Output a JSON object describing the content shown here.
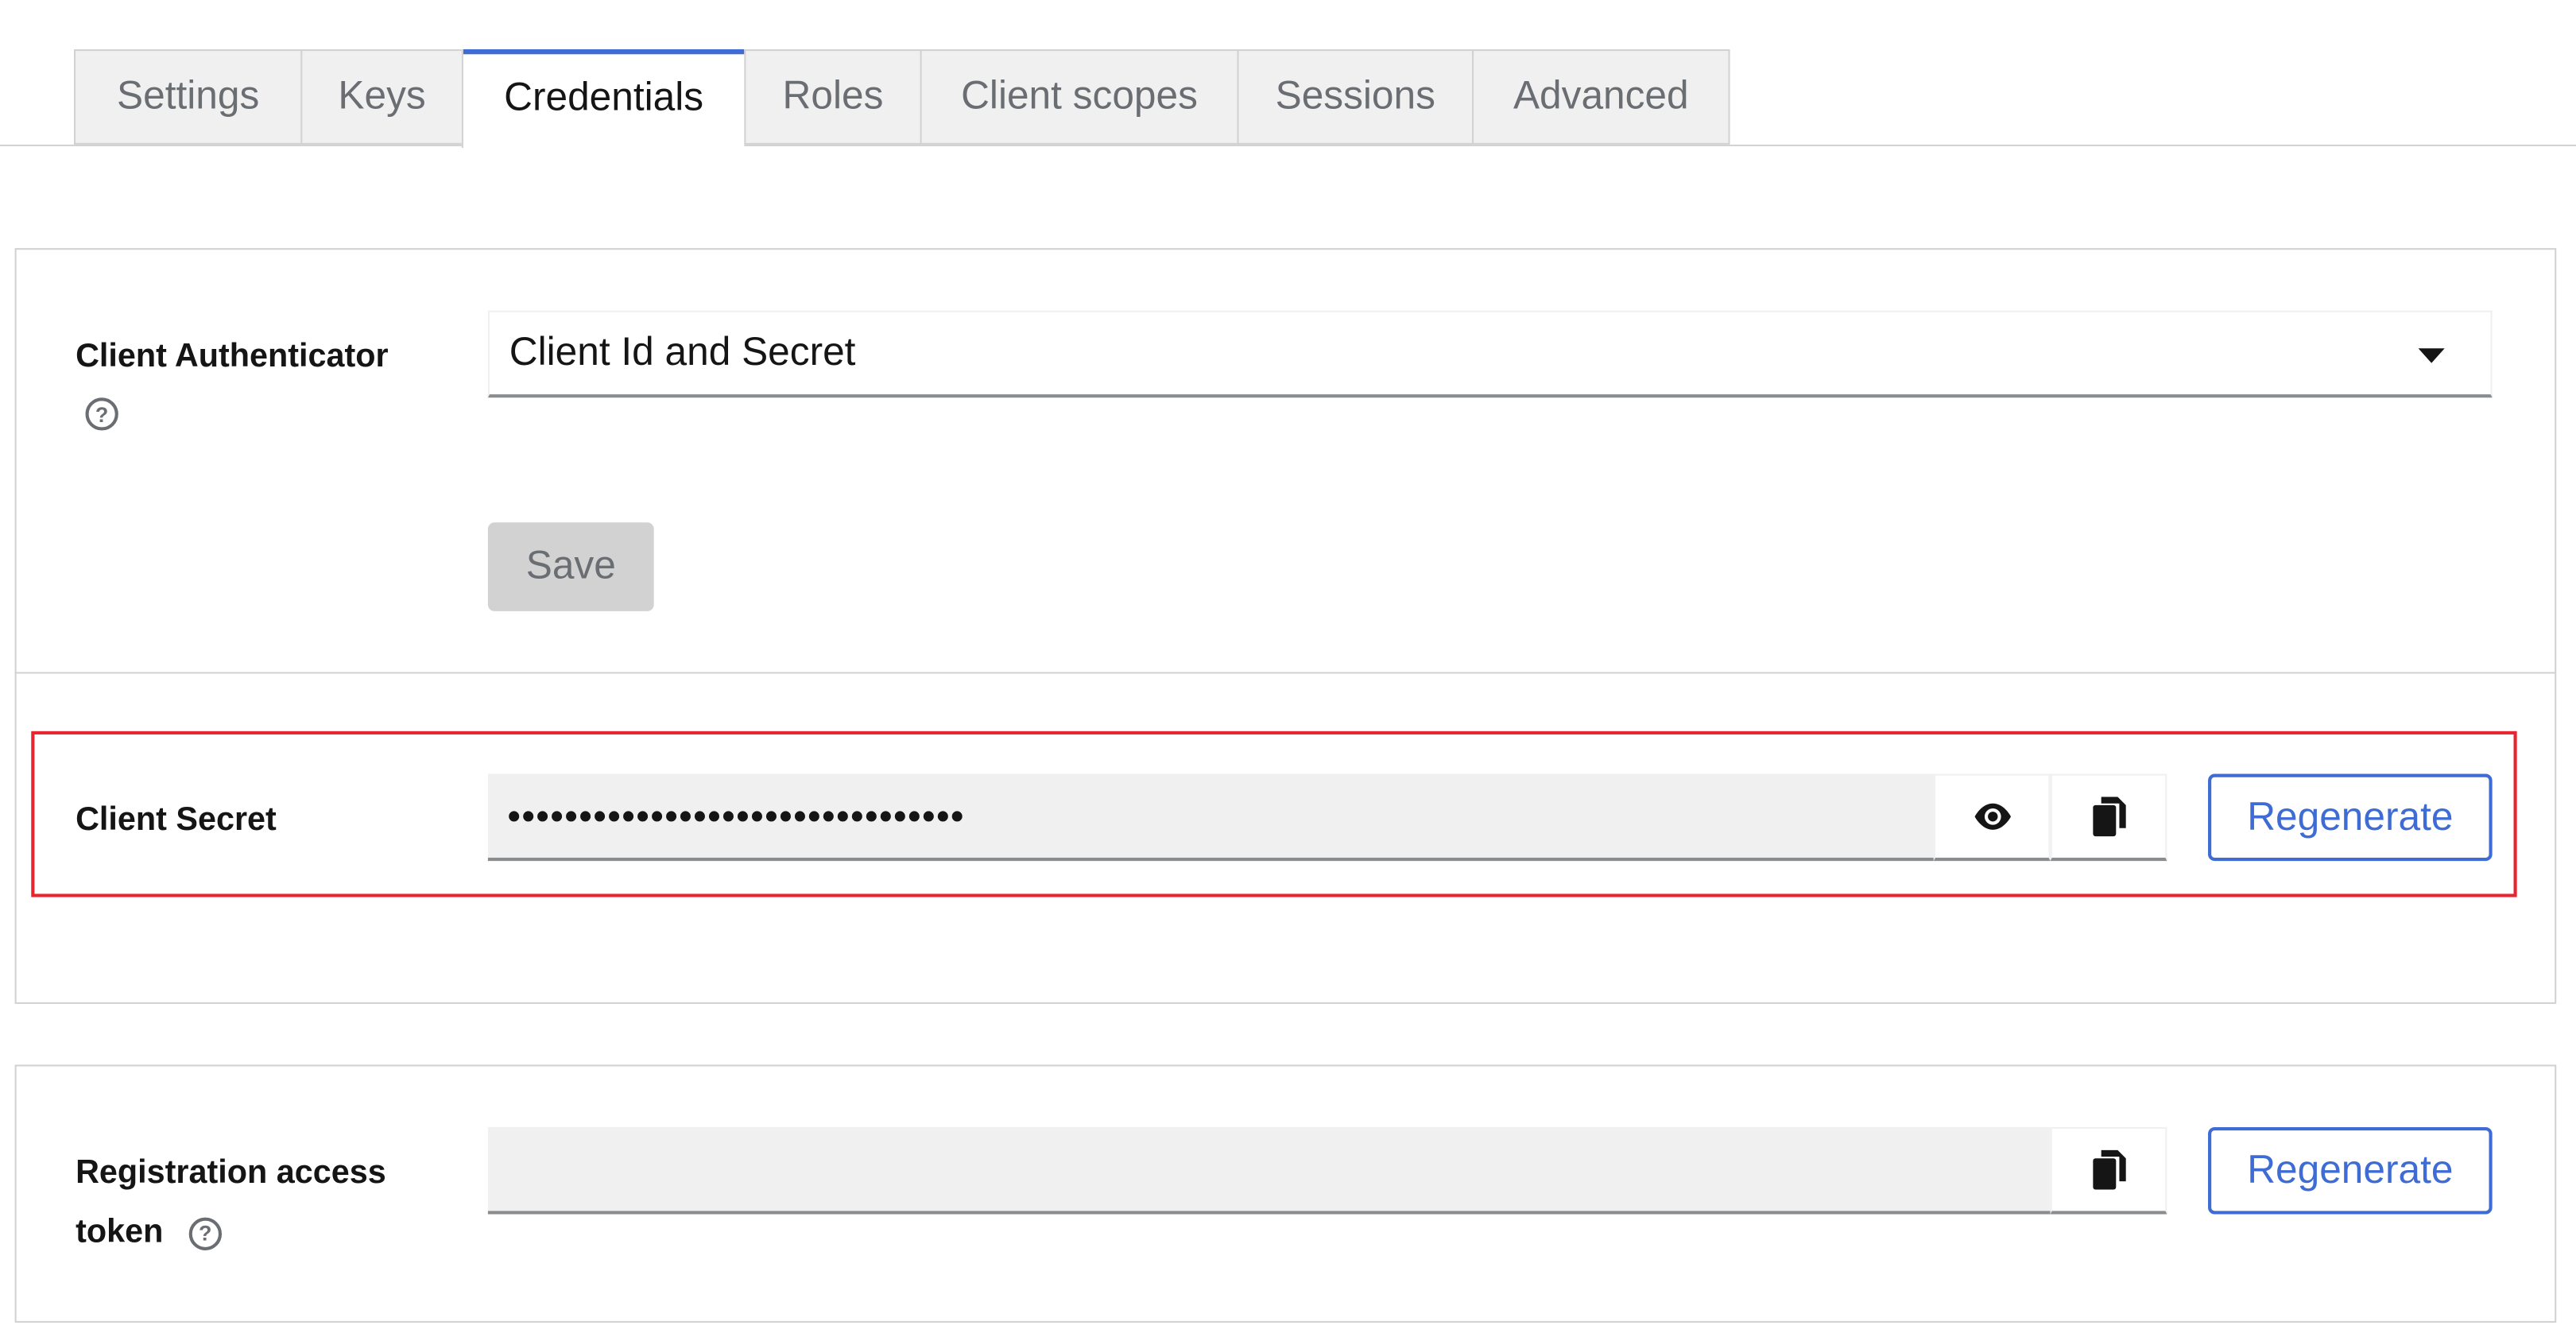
{
  "tabs": [
    {
      "label": "Settings"
    },
    {
      "label": "Keys"
    },
    {
      "label": "Credentials"
    },
    {
      "label": "Roles"
    },
    {
      "label": "Client scopes"
    },
    {
      "label": "Sessions"
    },
    {
      "label": "Advanced"
    }
  ],
  "active_tab": "Credentials",
  "authenticator": {
    "label": "Client Authenticator",
    "selected": "Client Id and Secret",
    "help_icon": "question-circle-icon",
    "save_label": "Save"
  },
  "client_secret": {
    "label": "Client Secret",
    "masked_value": "••••••••••••••••••••••••••••••••",
    "show_icon": "eye-icon",
    "copy_icon": "copy-icon",
    "regenerate_label": "Regenerate"
  },
  "registration_token": {
    "label_line1": "Registration access",
    "label_line2": "token",
    "help_icon": "question-circle-icon",
    "value": "",
    "copy_icon": "copy-icon",
    "regenerate_label": "Regenerate"
  },
  "colors": {
    "accent": "#3e6cd4",
    "highlight": "#e8242e",
    "field_bg": "#f0f0f0",
    "border": "#d2d2d2"
  }
}
